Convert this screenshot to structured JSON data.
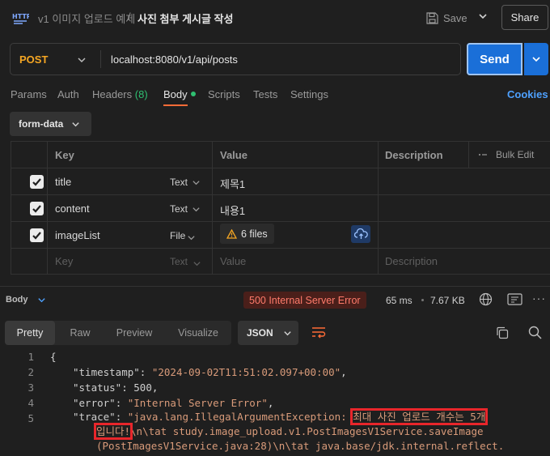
{
  "header": {
    "collection": "v1 이미지 업로드 예제",
    "separator": "/",
    "request_name": "사진 첨부 게시글 작성",
    "save_label": "Save",
    "share_label": "Share"
  },
  "request": {
    "method": "POST",
    "url": "localhost:8080/v1/api/posts",
    "send_label": "Send"
  },
  "tabs": [
    {
      "label": "Params"
    },
    {
      "label": "Auth"
    },
    {
      "label": "Headers",
      "count": "(8)"
    },
    {
      "label": "Body"
    },
    {
      "label": "Scripts"
    },
    {
      "label": "Tests"
    },
    {
      "label": "Settings"
    }
  ],
  "cookies_label": "Cookies",
  "body_mode": "form-data",
  "table": {
    "headers": {
      "key": "Key",
      "value": "Value",
      "description": "Description",
      "bulk_edit": "Bulk Edit"
    },
    "rows": [
      {
        "key": "title",
        "type": "Text",
        "value": "제목1",
        "checked": true
      },
      {
        "key": "content",
        "type": "Text",
        "value": "내용1",
        "checked": true
      },
      {
        "key": "imageList",
        "type": "File",
        "value": "6 files",
        "checked": true
      }
    ],
    "placeholder": {
      "key": "Key",
      "type": "Text",
      "value": "Value",
      "description": "Description"
    }
  },
  "response": {
    "label": "Body",
    "status": "500 Internal Server Error",
    "time": "65 ms",
    "size": "7.67 KB",
    "view_tabs": [
      "Pretty",
      "Raw",
      "Preview",
      "Visualize"
    ],
    "format": "JSON",
    "lines": {
      "l1": "{",
      "timestamp_key": "\"timestamp\"",
      "timestamp_val": "\"2024-09-02T11:51:02.097+00:00\"",
      "status_key": "\"status\"",
      "status_val": "500",
      "error_key": "\"error\"",
      "error_val": "\"Internal Server Error\"",
      "trace_key": "\"trace\"",
      "trace_a": "\"java.lang.IllegalArgumentException: ",
      "trace_hl1": "최대 사진 업로드 개수는 5개",
      "trace_hl2": "입니다!",
      "trace_b": "\\n\\tat study.image_upload.v1.PostImagesV1Service.saveImage",
      "trace_c": "(PostImagesV1Service.java:28)\\n\\tat java.base/jdk.internal.reflect."
    },
    "line_numbers": [
      "1",
      "2",
      "3",
      "4",
      "5"
    ]
  },
  "colors": {
    "accent": "#1a6fd8",
    "method": "#f5a623",
    "error": "#ff7b6b",
    "highlight": "#e8262b"
  }
}
